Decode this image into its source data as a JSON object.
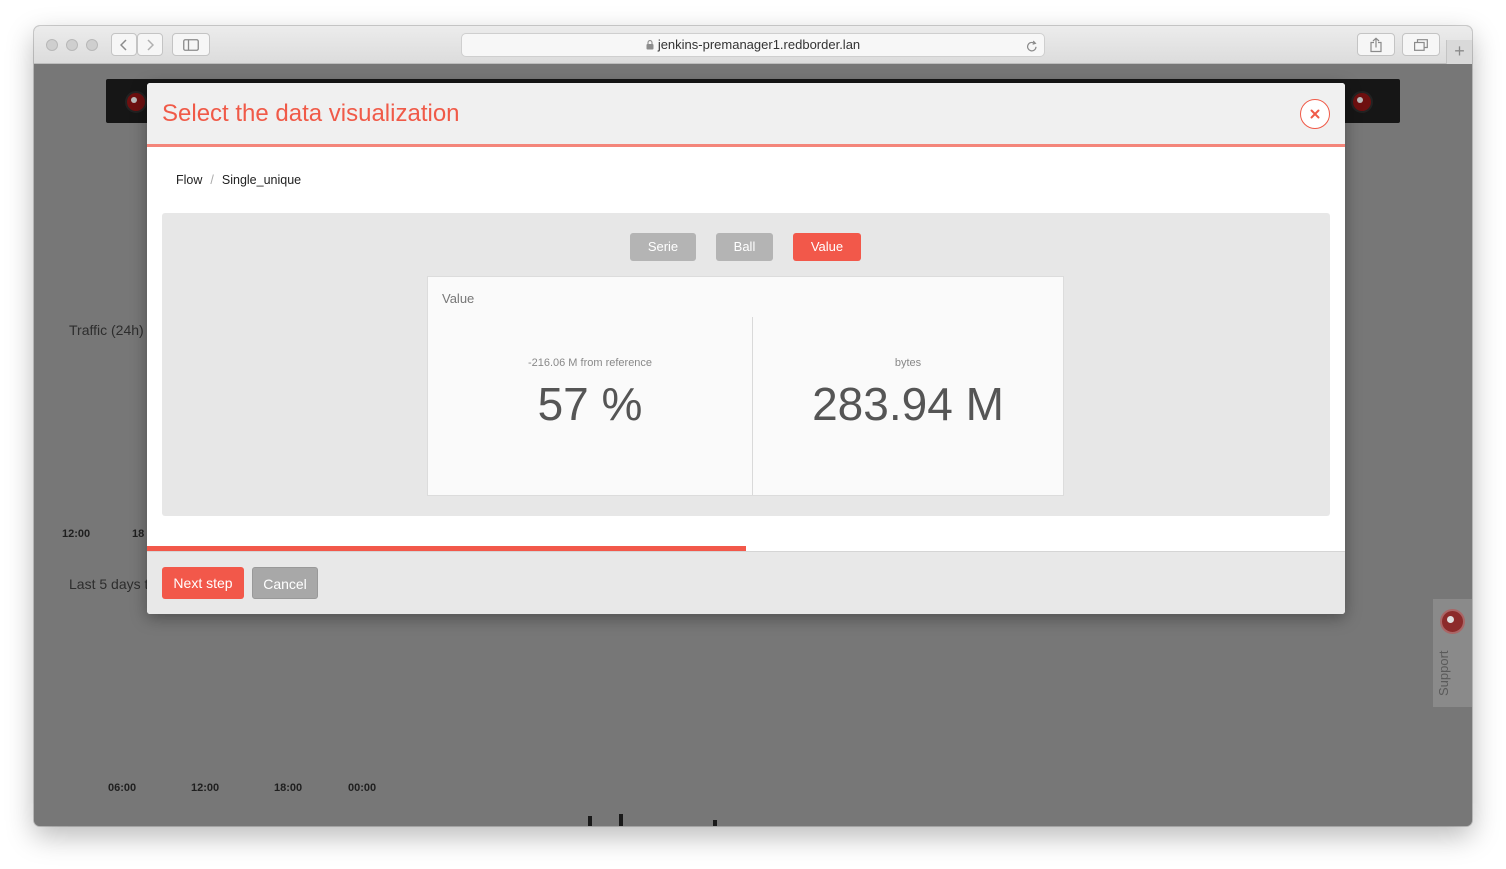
{
  "browser": {
    "url": "jenkins-premanager1.redborder.lan"
  },
  "background": {
    "traffic_label": "Traffic (24h)",
    "last_days_label": "Last 5 days t",
    "upper_ticks": [
      "12:00",
      "18"
    ],
    "lower_ticks": [
      "06:00",
      "12:00",
      "18:00",
      "00:00"
    ],
    "support_label": "Support"
  },
  "modal": {
    "title": "Select the data visualization",
    "breadcrumb": [
      "Flow",
      "Single_unique"
    ],
    "viz_options": [
      {
        "label": "Serie",
        "active": false
      },
      {
        "label": "Ball",
        "active": false
      },
      {
        "label": "Value",
        "active": true
      }
    ],
    "preview": {
      "title": "Value",
      "left": {
        "sub": "-216.06 M from reference",
        "value": "57 %"
      },
      "right": {
        "sub": "bytes",
        "value": "283.94 M"
      }
    },
    "progress_fraction": 0.5,
    "next_label": "Next step",
    "cancel_label": "Cancel"
  },
  "colors": {
    "accent": "#f2584a",
    "overlay": "#777777"
  }
}
